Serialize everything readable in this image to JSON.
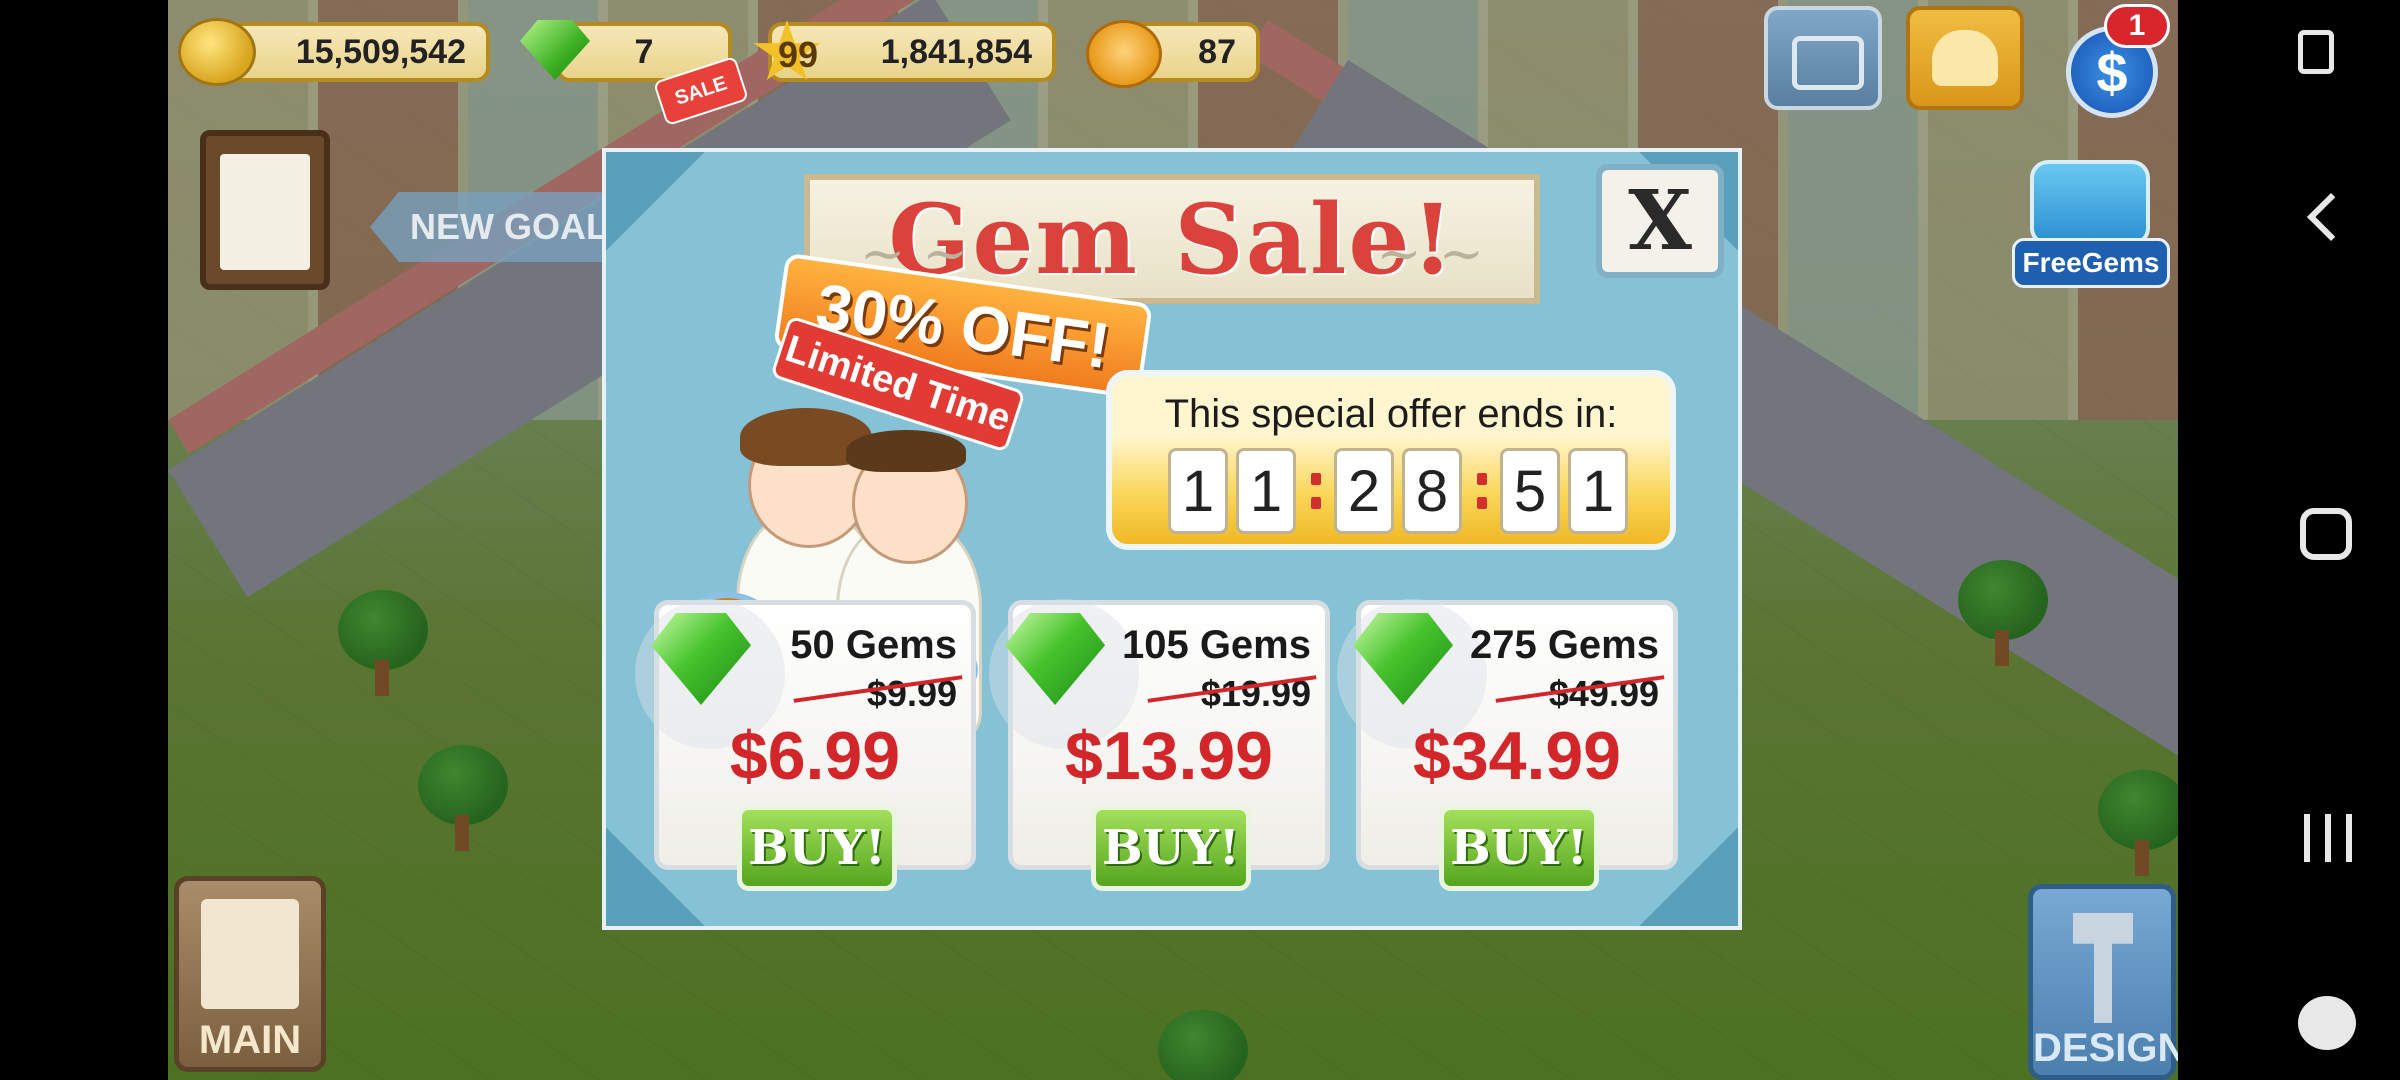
{
  "hud": {
    "coins": "15,509,542",
    "gems": "7",
    "gem_sale_tag": "SALE",
    "level": "99",
    "experience": "1,841,854",
    "happiness": "87",
    "cash_badge": "1",
    "cash_symbol": "$",
    "free_gems": "FreeGems"
  },
  "side": {
    "new_goal": "NEW GOAL",
    "main": "MAIN",
    "design": "DESIGN"
  },
  "dialog": {
    "title": "Gem Sale!",
    "discount": "30% OFF!",
    "limited": "Limited Time",
    "timer_label": "This special offer ends in:",
    "timer_digits": [
      "1",
      "1",
      "2",
      "8",
      "5",
      "1"
    ],
    "close": "X",
    "offers": [
      {
        "gems": "50 Gems",
        "old_price": "$9.99",
        "price": "$6.99",
        "buy": "BUY!"
      },
      {
        "gems": "105 Gems",
        "old_price": "$19.99",
        "price": "$13.99",
        "buy": "BUY!"
      },
      {
        "gems": "275 Gems",
        "old_price": "$49.99",
        "price": "$34.99",
        "buy": "BUY!"
      }
    ]
  },
  "colors": {
    "title_red": "#d9433c",
    "price_red": "#d3262a",
    "buy_green": "#55a51f",
    "dialog_blue": "#86c2d6",
    "timer_gold": "#f9d75a"
  },
  "icons": [
    "coin-icon",
    "gem-icon",
    "star-icon",
    "smiley-icon",
    "camera-icon",
    "phone-icon",
    "cash-icon",
    "tv-gem-icon",
    "clipboard-icon",
    "hammer-icon",
    "screenshot-icon",
    "back-icon",
    "home-icon",
    "recents-icon",
    "gamepad-icon"
  ]
}
